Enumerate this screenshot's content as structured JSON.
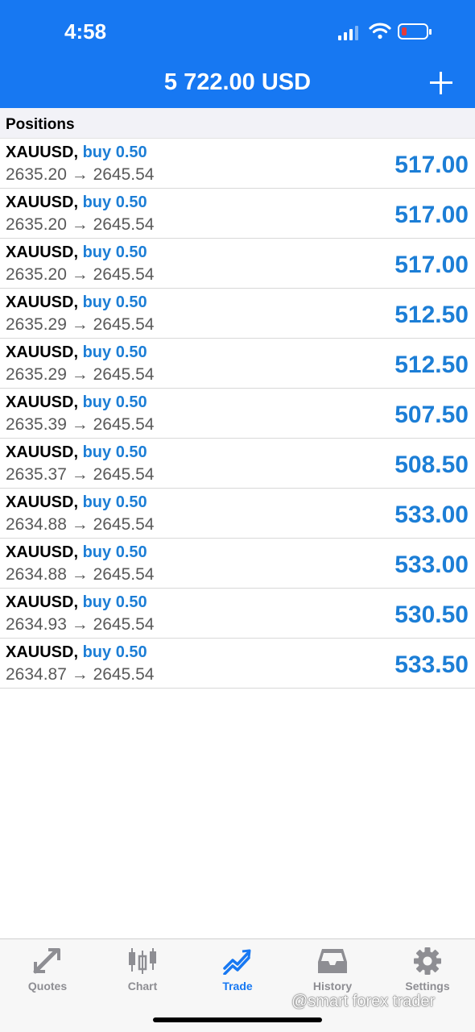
{
  "status_bar": {
    "time": "4:58"
  },
  "header": {
    "balance": "5 722.00 USD",
    "add_icon": "plus-icon"
  },
  "section": {
    "title": "Positions"
  },
  "positions": [
    {
      "symbol": "XAUUSD",
      "side": "buy 0.50",
      "prices": "2635.20 → 2645.54",
      "profit": "517.00"
    },
    {
      "symbol": "XAUUSD",
      "side": "buy 0.50",
      "prices": "2635.20 → 2645.54",
      "profit": "517.00"
    },
    {
      "symbol": "XAUUSD",
      "side": "buy 0.50",
      "prices": "2635.20 → 2645.54",
      "profit": "517.00"
    },
    {
      "symbol": "XAUUSD",
      "side": "buy 0.50",
      "prices": "2635.29 → 2645.54",
      "profit": "512.50"
    },
    {
      "symbol": "XAUUSD",
      "side": "buy 0.50",
      "prices": "2635.29 → 2645.54",
      "profit": "512.50"
    },
    {
      "symbol": "XAUUSD",
      "side": "buy 0.50",
      "prices": "2635.39 → 2645.54",
      "profit": "507.50"
    },
    {
      "symbol": "XAUUSD",
      "side": "buy 0.50",
      "prices": "2635.37 → 2645.54",
      "profit": "508.50"
    },
    {
      "symbol": "XAUUSD",
      "side": "buy 0.50",
      "prices": "2634.88 → 2645.54",
      "profit": "533.00"
    },
    {
      "symbol": "XAUUSD",
      "side": "buy 0.50",
      "prices": "2634.88 → 2645.54",
      "profit": "533.00"
    },
    {
      "symbol": "XAUUSD",
      "side": "buy 0.50",
      "prices": "2634.93 → 2645.54",
      "profit": "530.50"
    },
    {
      "symbol": "XAUUSD",
      "side": "buy 0.50",
      "prices": "2634.87 → 2645.54",
      "profit": "533.50"
    }
  ],
  "tabs": [
    {
      "label": "Quotes",
      "icon": "quotes-arrows-icon",
      "active": false
    },
    {
      "label": "Chart",
      "icon": "candlestick-chart-icon",
      "active": false
    },
    {
      "label": "Trade",
      "icon": "trade-trend-icon",
      "active": true
    },
    {
      "label": "History",
      "icon": "history-tray-icon",
      "active": false
    },
    {
      "label": "Settings",
      "icon": "gear-icon",
      "active": false
    }
  ],
  "watermark": "@smart forex trader",
  "colors": {
    "brand": "#1778F2",
    "profit": "#1C7ED6",
    "tab_inactive": "#8E8E93"
  }
}
